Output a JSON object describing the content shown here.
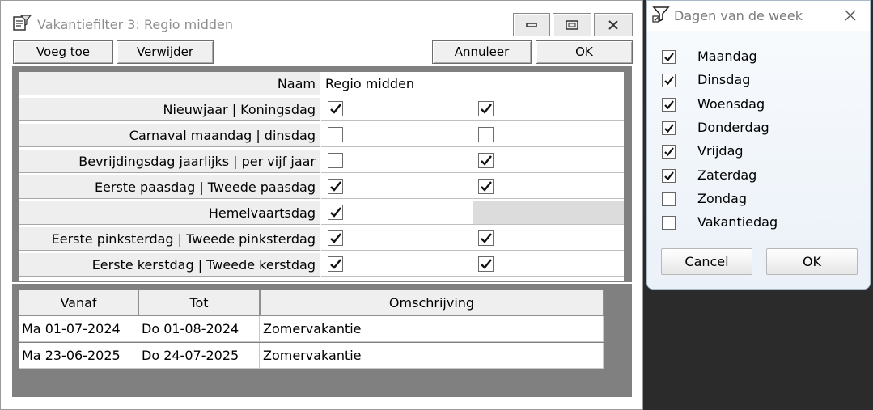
{
  "main_window": {
    "title": "Vakantiefilter 3: Regio midden",
    "toolbar": {
      "add_label": "Voeg toe",
      "remove_label": "Verwijder",
      "cancel_label": "Annuleer",
      "ok_label": "OK"
    },
    "name_row": {
      "label": "Naam",
      "value": "Regio midden"
    },
    "holiday_rows": [
      {
        "label": "Nieuwjaar | Koningsdag",
        "first": true,
        "second": true
      },
      {
        "label": "Carnaval maandag | dinsdag",
        "first": false,
        "second": false
      },
      {
        "label": "Bevrijdingsdag jaarlijks | per vijf jaar",
        "first": false,
        "second": true
      },
      {
        "label": "Eerste paasdag | Tweede paasdag",
        "first": true,
        "second": true
      },
      {
        "label": "Hemelvaartsdag",
        "first": true,
        "second": null
      },
      {
        "label": "Eerste pinksterdag | Tweede pinksterdag",
        "first": true,
        "second": true
      },
      {
        "label": "Eerste kerstdag | Tweede kerstdag",
        "first": true,
        "second": true
      }
    ],
    "vacation_table": {
      "headers": [
        "Vanaf",
        "Tot",
        "Omschrijving"
      ],
      "rows": [
        [
          "Ma 01-07-2024",
          "Do 01-08-2024",
          "Zomervakantie"
        ],
        [
          "Ma 23-06-2025",
          "Do 24-07-2025",
          "Zomervakantie"
        ]
      ]
    }
  },
  "days_dialog": {
    "title": "Dagen van de week",
    "days": [
      {
        "label": "Maandag",
        "checked": true
      },
      {
        "label": "Dinsdag",
        "checked": true
      },
      {
        "label": "Woensdag",
        "checked": true
      },
      {
        "label": "Donderdag",
        "checked": true
      },
      {
        "label": "Vrijdag",
        "checked": true
      },
      {
        "label": "Zaterdag",
        "checked": true
      },
      {
        "label": "Zondag",
        "checked": false
      },
      {
        "label": "Vakantiedag",
        "checked": false
      }
    ],
    "cancel_label": "Cancel",
    "ok_label": "OK"
  }
}
